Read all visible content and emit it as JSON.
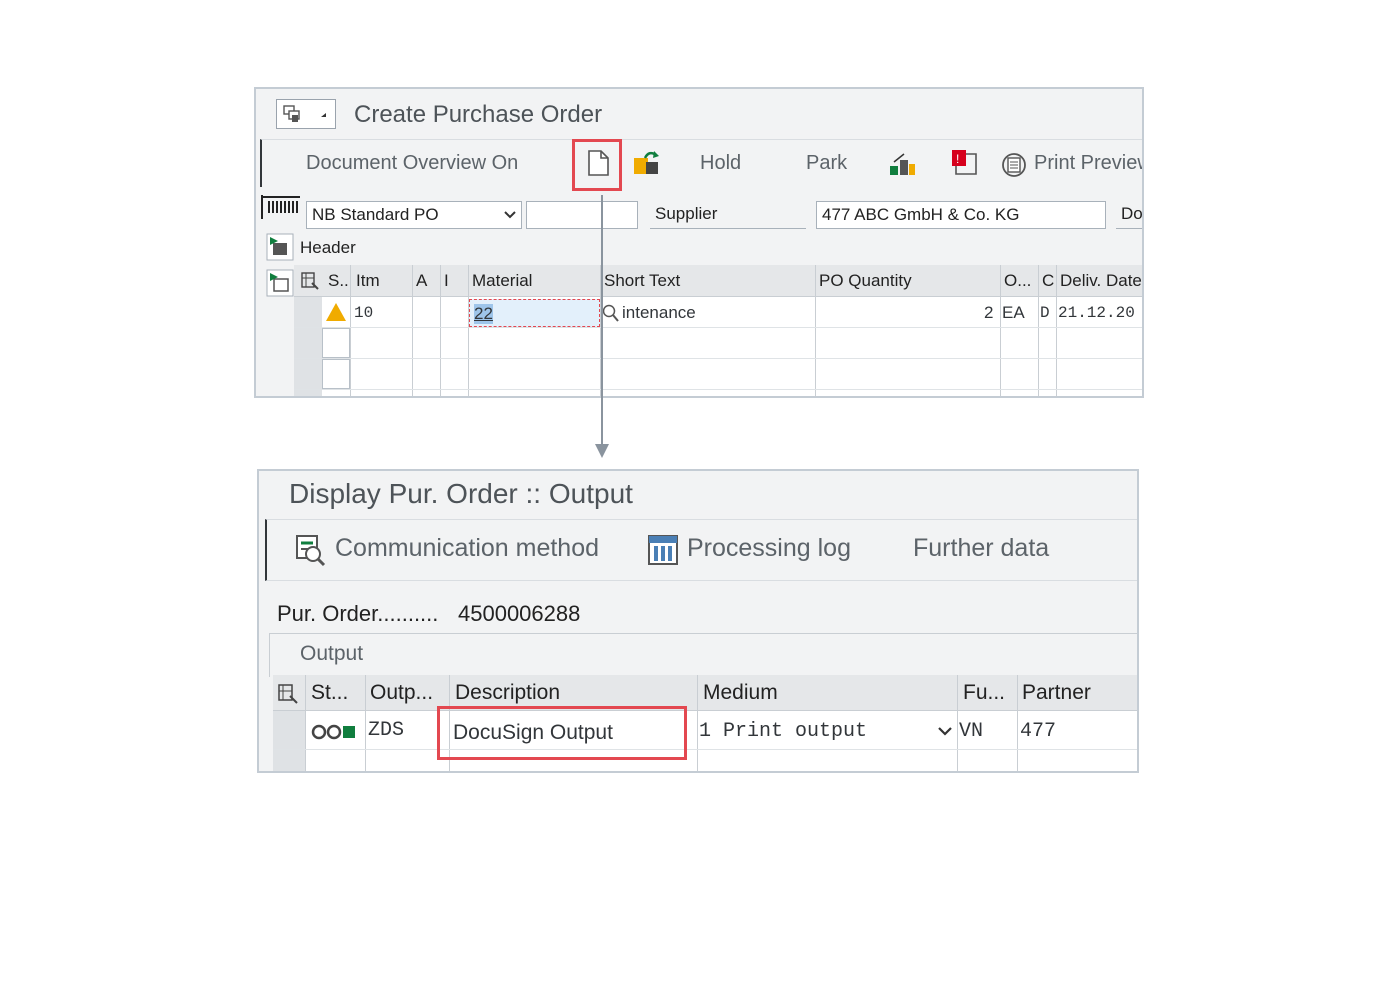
{
  "create_po": {
    "title": "Create Purchase Order",
    "toolbar": {
      "document_overview": "Document Overview On",
      "hold": "Hold",
      "park": "Park",
      "print_preview": "Print Preview"
    },
    "fields": {
      "doc_type": "NB Standard PO",
      "doc_number": "",
      "supplier_label": "Supplier",
      "supplier_value": "477 ABC GmbH & Co. KG",
      "truncated_label": "Do"
    },
    "header_label": "Header",
    "columns": [
      "S..",
      "Itm",
      "A",
      "I",
      "Material",
      "Short Text",
      "PO Quantity",
      "O...",
      "C",
      "Deliv. Date"
    ],
    "rows": [
      {
        "item": "10",
        "material": "22",
        "short_text": "intenance",
        "quantity": "2",
        "unit": "EA",
        "category": "D",
        "deliv_date": "21.12.20"
      }
    ]
  },
  "display_output": {
    "title": "Display Pur. Order :: Output",
    "toolbar": {
      "communication_method": "Communication method",
      "processing_log": "Processing log",
      "further_data": "Further data"
    },
    "po_label": "Pur. Order..........",
    "po_number": "4500006288",
    "section_label": "Output",
    "columns": [
      "St...",
      "Outp...",
      "Description",
      "Medium",
      "Fu...",
      "Partner"
    ],
    "rows": [
      {
        "output_type": "ZDS",
        "description": "DocuSign Output",
        "medium": "1 Print output",
        "function": "VN",
        "partner": "477"
      }
    ]
  },
  "colors": {
    "highlight": "#e34850",
    "warning": "#f0ab00",
    "status_green": "#107e3e"
  }
}
